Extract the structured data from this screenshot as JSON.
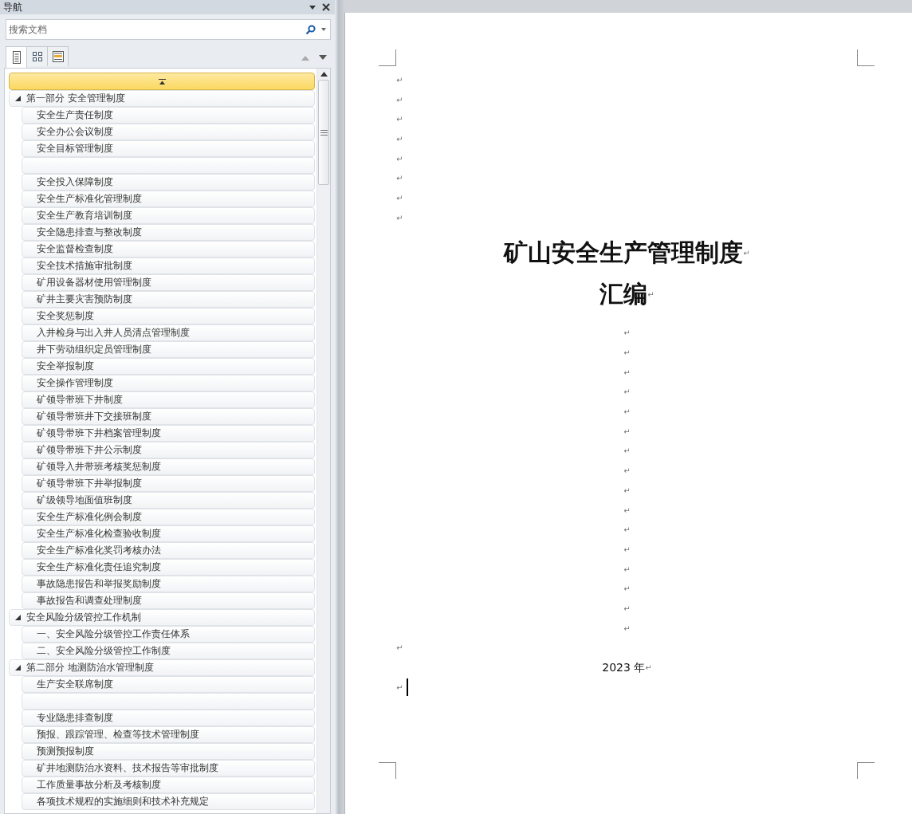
{
  "nav": {
    "title": "导航",
    "search": {
      "placeholder": "搜索文档"
    },
    "tabs": [
      {
        "kind": "headings",
        "selected": true
      },
      {
        "kind": "pages",
        "selected": false
      },
      {
        "kind": "results",
        "selected": false
      }
    ],
    "tree": [
      {
        "kind": "heading",
        "text": "第一部分 安全管理制度",
        "expanded": true,
        "children": [
          {
            "kind": "item",
            "text": "安全生产责任制度"
          },
          {
            "kind": "item",
            "text": "安全办公会议制度"
          },
          {
            "kind": "item",
            "text": "安全目标管理制度"
          },
          {
            "kind": "blank"
          },
          {
            "kind": "item",
            "text": "安全投入保障制度"
          },
          {
            "kind": "item",
            "text": "安全生产标准化管理制度"
          },
          {
            "kind": "item",
            "text": "安全生产教育培训制度"
          },
          {
            "kind": "item",
            "text": "安全隐患排查与整改制度"
          },
          {
            "kind": "item",
            "text": "安全监督检查制度"
          },
          {
            "kind": "item",
            "text": "安全技术措施审批制度"
          },
          {
            "kind": "item",
            "text": "矿用设备器材使用管理制度"
          },
          {
            "kind": "item",
            "text": "矿井主要灾害预防制度"
          },
          {
            "kind": "item",
            "text": "安全奖惩制度"
          },
          {
            "kind": "item",
            "text": "入井检身与出入井人员清点管理制度"
          },
          {
            "kind": "item",
            "text": "井下劳动组织定员管理制度"
          },
          {
            "kind": "item",
            "text": "安全举报制度"
          },
          {
            "kind": "item",
            "text": "安全操作管理制度"
          },
          {
            "kind": "item",
            "text": "矿领导带班下井制度"
          },
          {
            "kind": "item",
            "text": "矿领导带班井下交接班制度"
          },
          {
            "kind": "item",
            "text": "矿领导带班下井档案管理制度"
          },
          {
            "kind": "item",
            "text": "矿领导带班下井公示制度"
          },
          {
            "kind": "item",
            "text": "矿领导入井带班考核奖惩制度"
          },
          {
            "kind": "item",
            "text": "矿领导带班下井举报制度"
          },
          {
            "kind": "item",
            "text": "矿级领导地面值班制度"
          },
          {
            "kind": "item",
            "text": "安全生产标准化例会制度"
          },
          {
            "kind": "item",
            "text": "安全生产标准化检查验收制度"
          },
          {
            "kind": "item",
            "text": "安全生产标准化奖罚考核办法"
          },
          {
            "kind": "item",
            "text": "安全生产标准化责任追究制度"
          },
          {
            "kind": "item",
            "text": "事故隐患报告和举报奖励制度"
          },
          {
            "kind": "item",
            "text": "事故报告和调查处理制度"
          }
        ]
      },
      {
        "kind": "heading",
        "text": "安全风险分级管控工作机制",
        "expanded": true,
        "children": [
          {
            "kind": "item",
            "text": "一、安全风险分级管控工作责任体系"
          },
          {
            "kind": "item",
            "text": "二、安全风险分级管控工作制度"
          }
        ]
      },
      {
        "kind": "heading",
        "text": "第二部分  地测防治水管理制度",
        "expanded": true,
        "children": [
          {
            "kind": "item",
            "text": "生产安全联席制度"
          },
          {
            "kind": "blank"
          },
          {
            "kind": "item",
            "text": "专业隐患排查制度"
          },
          {
            "kind": "item",
            "text": "预报、跟踪管理、检查等技术管理制度"
          },
          {
            "kind": "item",
            "text": "预测预报制度"
          },
          {
            "kind": "item",
            "text": "矿井地测防治水资料、技术报告等审批制度"
          },
          {
            "kind": "item",
            "text": "工作质量事故分析及考核制度"
          },
          {
            "kind": "item",
            "text": "各项技术规程的实施细则和技术补充规定"
          }
        ]
      }
    ]
  },
  "document": {
    "paragraphs": [
      {
        "kind": "empty",
        "centered": false,
        "mark": "↵"
      },
      {
        "kind": "empty",
        "centered": false,
        "mark": "↵"
      },
      {
        "kind": "empty",
        "centered": false,
        "mark": "↵"
      },
      {
        "kind": "empty",
        "centered": false,
        "mark": "↵"
      },
      {
        "kind": "empty",
        "centered": false,
        "mark": "↵"
      },
      {
        "kind": "empty",
        "centered": false,
        "mark": "↵"
      },
      {
        "kind": "empty",
        "centered": false,
        "mark": "↵"
      },
      {
        "kind": "empty",
        "centered": false,
        "mark": "↵"
      },
      {
        "kind": "title",
        "centered": true,
        "text": "矿山安全生产管理制度",
        "mark": "↵"
      },
      {
        "kind": "title",
        "centered": true,
        "text": "汇编",
        "mark": "↵"
      },
      {
        "kind": "empty",
        "centered": true,
        "mark": "↵"
      },
      {
        "kind": "empty",
        "centered": true,
        "mark": "↵"
      },
      {
        "kind": "empty",
        "centered": true,
        "mark": "↵"
      },
      {
        "kind": "empty",
        "centered": true,
        "mark": "↵"
      },
      {
        "kind": "empty",
        "centered": true,
        "mark": "↵"
      },
      {
        "kind": "empty",
        "centered": true,
        "mark": "↵"
      },
      {
        "kind": "empty",
        "centered": true,
        "mark": "↵"
      },
      {
        "kind": "empty",
        "centered": true,
        "mark": "↵"
      },
      {
        "kind": "empty",
        "centered": true,
        "mark": "↵"
      },
      {
        "kind": "empty",
        "centered": true,
        "mark": "↵"
      },
      {
        "kind": "empty",
        "centered": true,
        "mark": "↵"
      },
      {
        "kind": "empty",
        "centered": true,
        "mark": "↵"
      },
      {
        "kind": "empty",
        "centered": true,
        "mark": "↵"
      },
      {
        "kind": "empty",
        "centered": true,
        "mark": "↵"
      },
      {
        "kind": "empty",
        "centered": true,
        "mark": "↵"
      },
      {
        "kind": "empty",
        "centered": true,
        "mark": "↵"
      },
      {
        "kind": "empty",
        "centered": false,
        "mark": "↵"
      },
      {
        "kind": "body",
        "centered": true,
        "text": "2023 年",
        "mark": "↵"
      },
      {
        "kind": "empty",
        "centered": false,
        "mark": "↵",
        "cursor": true
      }
    ]
  }
}
